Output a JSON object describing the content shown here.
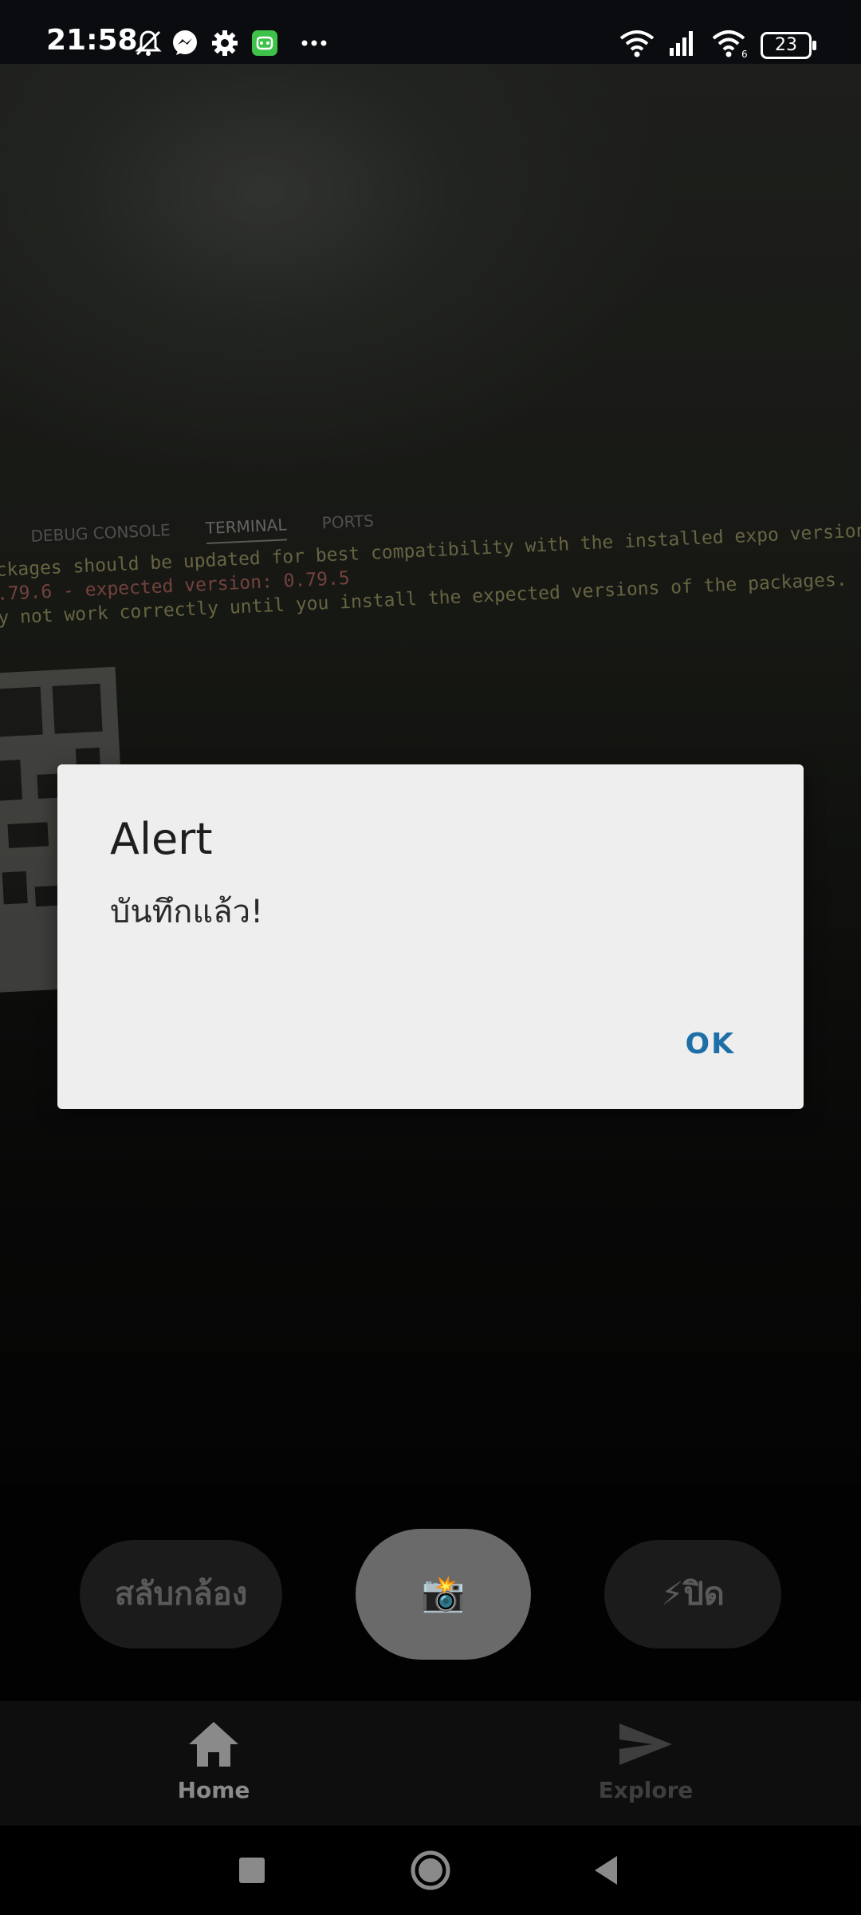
{
  "status_bar": {
    "time": "21:58",
    "battery": "23",
    "icons": [
      "bell-off-icon",
      "messenger-icon",
      "gear-icon",
      "android-app-icon",
      "more-icon",
      "wifi-icon",
      "signal-icon",
      "wifi-6-icon"
    ]
  },
  "camera_preview": {
    "tabs": [
      "DEBUG CONSOLE",
      "TERMINAL",
      "PORTS"
    ],
    "active_tab": "TERMINAL",
    "lines": [
      "ckages should be updated for best compatibility with the installed expo version:",
      ".79.6 - expected version: 0.79.5",
      "y not work correctly until you install the expected versions of the packages."
    ]
  },
  "dialog": {
    "title": "Alert",
    "message": "บันทึกแล้ว!",
    "ok_label": "OK"
  },
  "controls": {
    "switch_camera": "สลับกล้อง",
    "shutter": "📸",
    "flash": "⚡ปิด"
  },
  "bottom_nav": {
    "items": [
      {
        "label": "Home",
        "icon": "home-icon"
      },
      {
        "label": "Explore",
        "icon": "send-icon"
      }
    ]
  },
  "system_nav": [
    "recents-icon",
    "home-circle-icon",
    "back-icon"
  ]
}
